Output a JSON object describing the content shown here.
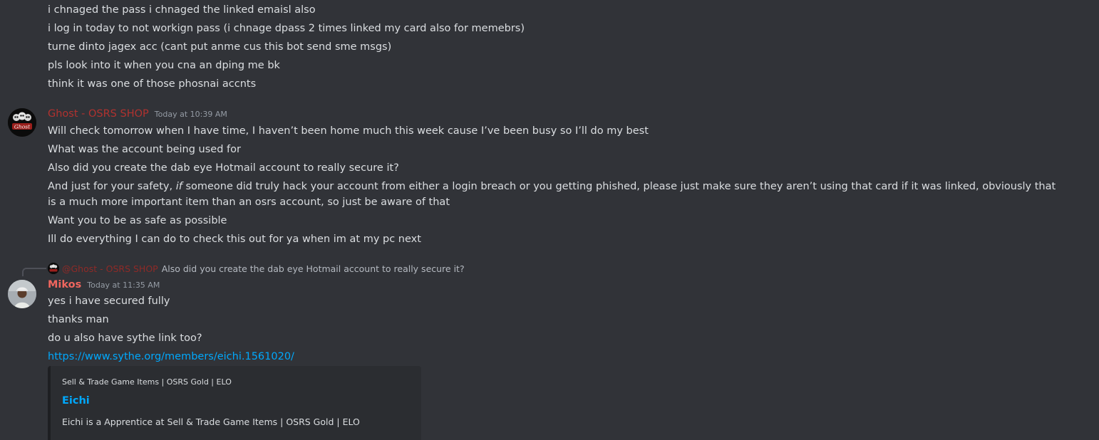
{
  "previous_messages": [
    "i chnaged the pass i chnaged the linked emaisl also",
    "i log in today to not workign pass (i chnage dpass 2 times linked my card also for memebrs)",
    "turne dinto jagex acc (cant put anme cus this bot send sme msgs)",
    "pls look into it when you cna an dping me bk",
    "think it was one of those phosnai accnts"
  ],
  "ghost_message": {
    "username": "Ghost - OSRS SHOP",
    "timestamp": "Today at 10:39 AM",
    "avatar_icon": "ghost-logo-icon",
    "lines": [
      "Will check tomorrow when I have time, I haven’t been home much this week cause I’ve been busy so I’ll do my best",
      "What was the account being used for",
      "Also did you create the dab eye Hotmail account to really secure it?"
    ],
    "safety_line": {
      "before": "And just for your safety, ",
      "emphasis": "if",
      "after": " someone did truly hack your account from either a login breach or you getting phished, please just make sure they aren’t using that card if it was linked, obviously that is a much more important item than an osrs account, so just be aware of that"
    },
    "closing_lines": [
      "Want you to be as safe as possible",
      "Ill do everything I can do to check this out for ya when im at my pc next"
    ]
  },
  "mikos_message": {
    "reply": {
      "mention": "@Ghost - OSRS SHOP",
      "text": "Also did you create the dab eye Hotmail account to really secure it?"
    },
    "username": "Mikos",
    "timestamp": "Today at 11:35 AM",
    "avatar_icon": "user-avatar-icon",
    "lines": [
      "yes i have secured fully",
      "thanks man",
      "do u also have sythe link too?"
    ],
    "link": "https://www.sythe.org/members/eichi.1561020/",
    "embed": {
      "provider": "Sell & Trade Game Items | OSRS Gold | ELO",
      "title": "Eichi",
      "description": "Eichi is a Apprentice at Sell & Trade Game Items | OSRS Gold | ELO"
    }
  },
  "colors": {
    "background": "#313338",
    "ghost_name": "#b1322f",
    "mikos_name": "#f0665e",
    "link": "#00a8fc",
    "embed_bg": "#2b2d31"
  }
}
